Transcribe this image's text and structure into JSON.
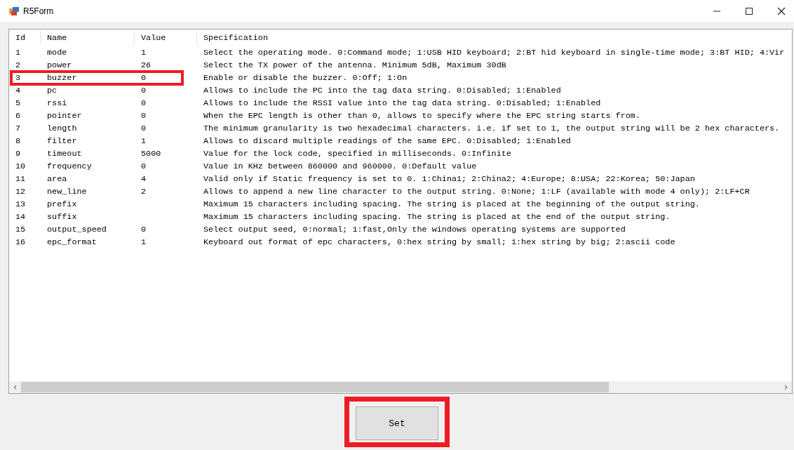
{
  "window": {
    "title": "R5Form"
  },
  "table": {
    "columns": [
      "Id",
      "Name",
      "Value",
      "Specification"
    ],
    "rows": [
      {
        "id": "1",
        "name": "mode",
        "value": "1",
        "spec": "Select the operating mode. 0:Command mode; 1:USB HID keyboard; 2:BT hid keyboard in single-time mode; 3:BT HID; 4:Vir",
        "highlighted": false
      },
      {
        "id": "2",
        "name": "power",
        "value": "26",
        "spec": "Select the TX power of the antenna. Minimum 5dB, Maximum 30dB",
        "highlighted": false
      },
      {
        "id": "3",
        "name": "buzzer",
        "value": "0",
        "spec": "Enable or disable the buzzer. 0:Off; 1:On",
        "highlighted": true
      },
      {
        "id": "4",
        "name": "pc",
        "value": "0",
        "spec": "Allows to include the PC into the tag data string. 0:Disabled; 1:Enabled",
        "highlighted": false
      },
      {
        "id": "5",
        "name": "rssi",
        "value": "0",
        "spec": "Allows to include the RSSI value into the tag data string. 0:Disabled; 1:Enabled",
        "highlighted": false
      },
      {
        "id": "6",
        "name": "pointer",
        "value": "0",
        "spec": "When the EPC length is other than 0, allows to specify where the EPC string starts from.",
        "highlighted": false
      },
      {
        "id": "7",
        "name": "length",
        "value": "0",
        "spec": "The minimum granularity is two hexadecimal characters. i.e. if set to 1, the output string will be 2 hex characters.",
        "highlighted": false
      },
      {
        "id": "8",
        "name": "filter",
        "value": "1",
        "spec": "Allows to discard multiple readings of the same EPC. 0:Disabled; 1:Enabled",
        "highlighted": false
      },
      {
        "id": "9",
        "name": "timeout",
        "value": "5000",
        "spec": "Value for the lock code, specified in milliseconds. 0:Infinite",
        "highlighted": false
      },
      {
        "id": "10",
        "name": "frequency",
        "value": "0",
        "spec": "Value in KHz between 860000 and 960000. 0:Default value",
        "highlighted": false
      },
      {
        "id": "11",
        "name": "area",
        "value": "4",
        "spec": "Valid only if Static frequency is set to 0. 1:China1; 2:China2; 4:Europe; 8:USA; 22:Korea; 50:Japan",
        "highlighted": false
      },
      {
        "id": "12",
        "name": "new_line",
        "value": "2",
        "spec": "Allows to append a new line character to the output string. 0:None; 1:LF (available with mode 4 only); 2:LF+CR",
        "highlighted": false
      },
      {
        "id": "13",
        "name": "prefix",
        "value": "",
        "spec": "Maximum 15 characters including spacing. The string is placed at the beginning of the output string.",
        "highlighted": false
      },
      {
        "id": "14",
        "name": "suffix",
        "value": "",
        "spec": "Maximum 15 characters including spacing. The string is placed at the end of the output string.",
        "highlighted": false
      },
      {
        "id": "15",
        "name": "output_speed",
        "value": "0",
        "spec": "Select output seed, 0:normal; 1:fast,Only the windows operating systems are supported",
        "highlighted": false
      },
      {
        "id": "16",
        "name": "epc_format",
        "value": "1",
        "spec": "Keyboard out format of epc characters, 0:hex string by small; 1:hex string by big; 2:ascii code",
        "highlighted": false
      }
    ],
    "scroll_left": "‹",
    "scroll_right": "›"
  },
  "button": {
    "label": "Set",
    "highlighted": true
  }
}
